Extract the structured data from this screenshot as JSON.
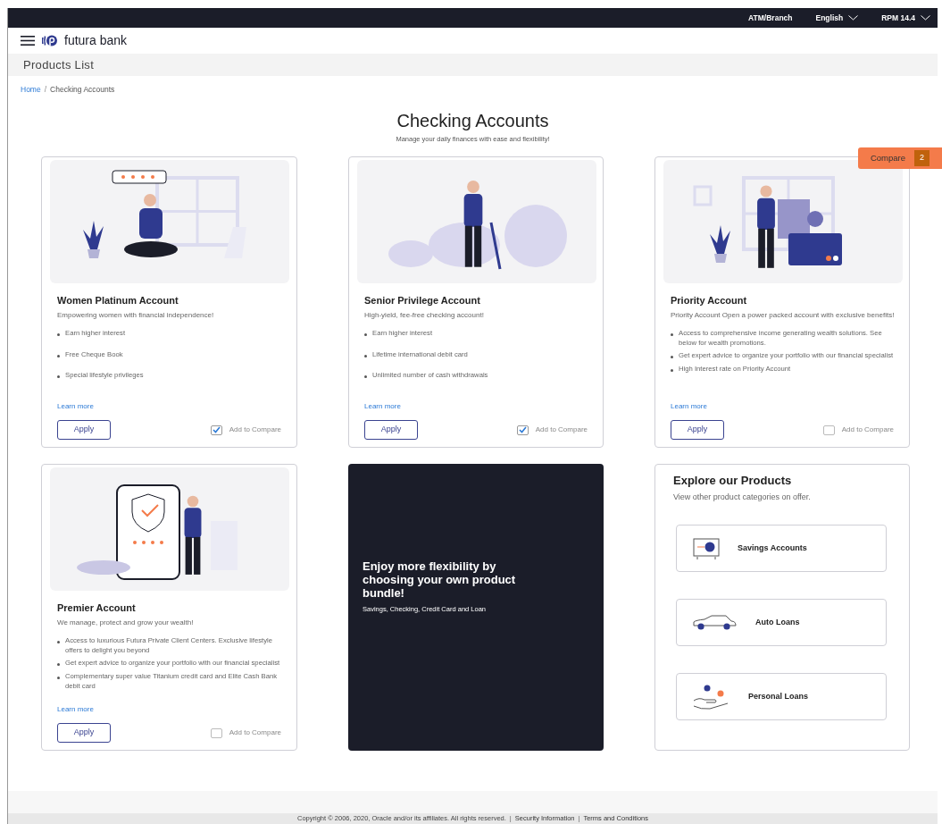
{
  "top_bar": {
    "links": [
      {
        "label": "ATM/Branch",
        "dropdown": false
      },
      {
        "label": "English",
        "dropdown": true
      },
      {
        "label": "RPM 14.4",
        "dropdown": true
      }
    ]
  },
  "header": {
    "brand": "futura bank"
  },
  "page_title": "Products List",
  "breadcrumb": [
    {
      "kind": "link",
      "label": "Home"
    },
    {
      "kind": "separator",
      "label": "/"
    },
    {
      "kind": "current",
      "label": "Checking Accounts"
    }
  ],
  "heading": "Checking Accounts",
  "subheading": "Manage your daily finances with ease and flexibility!",
  "compare": {
    "label": "Compare",
    "count": "2"
  },
  "products": [
    {
      "kind": "reader",
      "name": "Women Platinum Account",
      "tagline": "Empowering women with financial independence!",
      "spaced": true,
      "features": [
        "Earn higher interest",
        "Free Cheque Book",
        "Special lifestyle privileges"
      ],
      "learn_more": "Learn more",
      "apply": "Apply",
      "compare_label": "Add to Compare",
      "checked": true
    },
    {
      "kind": "walker",
      "name": "Senior Privilege Account",
      "tagline": "High-yield, fee-free checking account!",
      "spaced": true,
      "features": [
        "Earn higher interest",
        "Lifetime international debit card",
        "Unlimited number of cash withdrawals"
      ],
      "learn_more": "Learn more",
      "apply": "Apply",
      "compare_label": "Add to Compare",
      "checked": true
    },
    {
      "kind": "finance",
      "name": "Priority Account",
      "tagline": "Priority Account Open a power packed account with exclusive benefits!",
      "spaced": false,
      "features": [
        "Access to comprehensive income generating wealth solutions. See below for wealth promotions.",
        "Get expert advice to organize your portfolio with our financial specialist",
        "High Interest rate on Priority Account"
      ],
      "learn_more": "Learn more",
      "apply": "Apply",
      "compare_label": "Add to Compare",
      "checked": false
    },
    {
      "kind": "security",
      "name": "Premier Account",
      "tagline": "We manage, protect and grow your wealth!",
      "spaced": false,
      "features": [
        "Access to luxurious Futura Private Client Centers. Exclusive lifestyle offers to delight you beyond",
        "Get expert advice to organize your portfolio with our financial specialist",
        "Complementary super value Titanium credit card and Elite Cash Bank debit card"
      ],
      "learn_more": "Learn more",
      "apply": "Apply",
      "compare_label": "Add to Compare",
      "checked": false
    }
  ],
  "promo": {
    "title": "Enjoy more flexibility by choosing your own product bundle!",
    "subtitle": "Savings, Checking, Credit Card and Loan"
  },
  "explore": {
    "title": "Explore our Products",
    "subtitle": "View other product categories on offer.",
    "categories": [
      {
        "kind": "safe",
        "label": "Savings Accounts"
      },
      {
        "kind": "car",
        "label": "Auto Loans"
      },
      {
        "kind": "hand",
        "label": "Personal Loans"
      }
    ]
  },
  "footer": {
    "segments": [
      {
        "kind": "text",
        "text": "Copyright © 2006, 2020, Oracle and/or its affiliates. All rights reserved."
      },
      {
        "kind": "separator",
        "text": "|"
      },
      {
        "kind": "link",
        "text": "Security Information"
      },
      {
        "kind": "separator",
        "text": "|"
      },
      {
        "kind": "link",
        "text": "Terms and Conditions"
      }
    ]
  }
}
